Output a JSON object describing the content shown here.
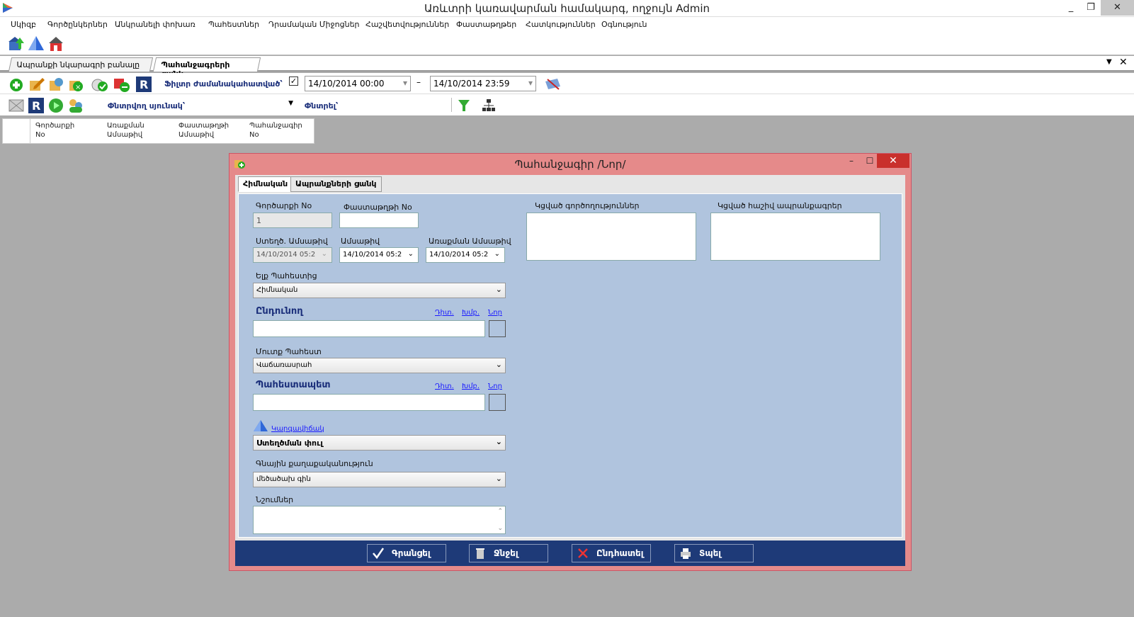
{
  "window": {
    "title": "Առևտրի կառավարման համակարգ, ողջույն Admin",
    "minimize": "_",
    "restore": "❐",
    "close": "✕"
  },
  "menu": [
    "Սկիզբ",
    "Գործընկերներ",
    "Անկրանելի փոխառ",
    "Պահեստներ",
    "Դրամական Միջոցներ",
    "Հաշվետվություններ",
    "Փաստաթղթեր",
    "Հատկություններ",
    "Օգնություն"
  ],
  "doc_tabs": [
    "Ապրանքի նկարագրի բանալը ...",
    "Պահանջագրերի ցանկ"
  ],
  "filter": {
    "period_label": "Ֆիլտր ժամանակահատված՝",
    "checked": "✓",
    "date_from": "14/10/2014 00:00",
    "date_to": "14/10/2014 23:59",
    "dash": "–"
  },
  "search": {
    "column_label": "Փնտրվող սյունակ՝",
    "search_label": "Փնտրել՝"
  },
  "grid_headers": [
    {
      "l1": "Գործարքի",
      "l2": "No"
    },
    {
      "l1": "Առաքման",
      "l2": "Ամսաթիվ"
    },
    {
      "l1": "Փաստաթղթի",
      "l2": "Ամսաթիվ"
    },
    {
      "l1": "Պահանջագիր",
      "l2": "No"
    }
  ],
  "dialog": {
    "title": "Պահանջագիր /Նոր/",
    "tabs": [
      "Հիմնական",
      "Ապրանքների ցանկ"
    ],
    "deal_no_label": "Գործարքի No",
    "deal_no": "1",
    "doc_no_label": "Փաստաթղթի No",
    "created_label": "Ստեղծ. Ամսաթիվ",
    "created": "14/10/2014 05:2",
    "date_label": "Ամսաթիվ",
    "date": "14/10/2014 05:2",
    "delivery_label": "Առաքման Ամսաթիվ",
    "delivery": "14/10/2014 05:2",
    "from_store_label": "Ելք Պահեստից",
    "from_store": "Հիմնական",
    "receiver_label": "Ընդունող",
    "link_edit": "Դիտ.",
    "link_search": "Խմբ.",
    "link_new": "Նոր",
    "to_store_label": "Մուտք Պահեստ",
    "to_store": "Վաճառասրահ",
    "keeper_label": "Պահեստապետ",
    "status_link": "Կարգավիճակ",
    "status": "Ստեղծման փուլ",
    "price_policy_label": "Գնային քաղաքականություն",
    "price_policy": "մեծածախ գին",
    "note_label": "Նշումներ",
    "linked_ops_label": "Կցված գործողություններ",
    "linked_invoices_label": "Կցված հաշիվ ապրանքագրեր",
    "buttons": [
      "Գրանցել",
      "Ջնջել",
      "Ընդհատել",
      "Տպել"
    ]
  }
}
